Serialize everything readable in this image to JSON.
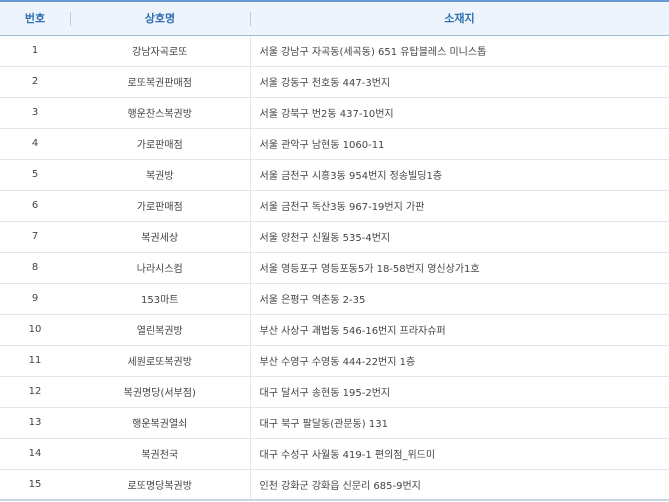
{
  "table": {
    "headers": [
      "번호",
      "상호명",
      "소재지"
    ],
    "rows": [
      {
        "no": "1",
        "name": "강남자곡로또",
        "address": "서울 강남구 자곡동(세곡동) 651 유탑블레스 미니스톱"
      },
      {
        "no": "2",
        "name": "로또복권판매점",
        "address": "서울 강동구 천호동 447-3번지"
      },
      {
        "no": "3",
        "name": "행운찬스복권방",
        "address": "서울 강북구 번2동 437-10번지"
      },
      {
        "no": "4",
        "name": "가로판매점",
        "address": "서울 관악구 남현동 1060-11"
      },
      {
        "no": "5",
        "name": "복권방",
        "address": "서울 금천구 시흥3동 954번지 정송빌딩1층"
      },
      {
        "no": "6",
        "name": "가로판매점",
        "address": "서울 금천구 독산3동 967-19번지 가판"
      },
      {
        "no": "7",
        "name": "복권세상",
        "address": "서울 양천구 신월동 535-4번지"
      },
      {
        "no": "8",
        "name": "나라시스컴",
        "address": "서울 영등포구 영등포동5가 18-58번지 영신상가1호"
      },
      {
        "no": "9",
        "name": "153마트",
        "address": "서울 은평구 역촌동 2-35"
      },
      {
        "no": "10",
        "name": "열린복권방",
        "address": "부산 사상구 괘법동 546-16번지 프라자슈퍼"
      },
      {
        "no": "11",
        "name": "세원로또복권방",
        "address": "부산 수영구 수영동 444-22번지 1층"
      },
      {
        "no": "12",
        "name": "복권명당(서부점)",
        "address": "대구 달서구 송현동 195-2번지"
      },
      {
        "no": "13",
        "name": "행운복권열쇠",
        "address": "대구 북구 팔달동(관문동) 131"
      },
      {
        "no": "14",
        "name": "복권천국",
        "address": "대구 수성구 사월동 419-1 편의점_위드미"
      },
      {
        "no": "15",
        "name": "로또명당복권방",
        "address": "인천 강화군 강화읍 신문리 685-9번지"
      }
    ]
  }
}
